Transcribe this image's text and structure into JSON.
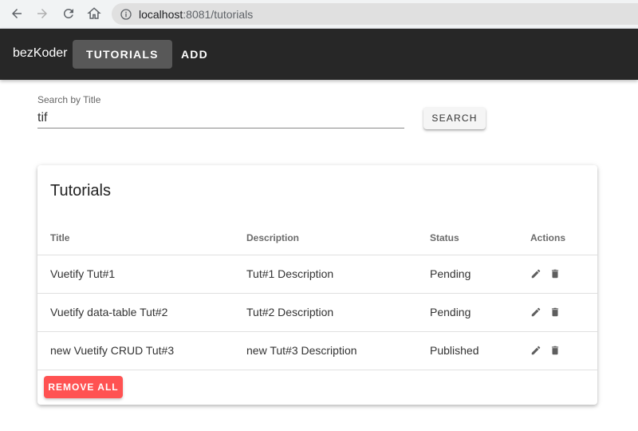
{
  "browser": {
    "url_host": "localhost",
    "url_rest": ":8081/tutorials"
  },
  "appbar": {
    "brand": "bezKoder",
    "nav": [
      {
        "label": "Tutorials"
      },
      {
        "label": "Add"
      }
    ]
  },
  "search": {
    "label": "Search by Title",
    "value": "tif",
    "button": "Search"
  },
  "card": {
    "title": "Tutorials",
    "columns": [
      "Title",
      "Description",
      "Status",
      "Actions"
    ],
    "rows": [
      {
        "title": "Vuetify Tut#1",
        "description": "Tut#1 Description",
        "status": "Pending"
      },
      {
        "title": "Vuetify data-table Tut#2",
        "description": "Tut#2 Description",
        "status": "Pending"
      },
      {
        "title": "new Vuetify CRUD Tut#3",
        "description": "new Tut#3 Description",
        "status": "Published"
      }
    ],
    "remove_all": "Remove All"
  },
  "icons": {
    "back": "arrow-left-icon",
    "forward": "arrow-right-icon",
    "reload": "reload-icon",
    "home": "home-icon",
    "info": "info-icon",
    "edit": "pencil-icon",
    "delete": "trash-icon"
  },
  "colors": {
    "appbar": "#272727",
    "active_tab": "#585858",
    "danger": "#ff5252"
  }
}
